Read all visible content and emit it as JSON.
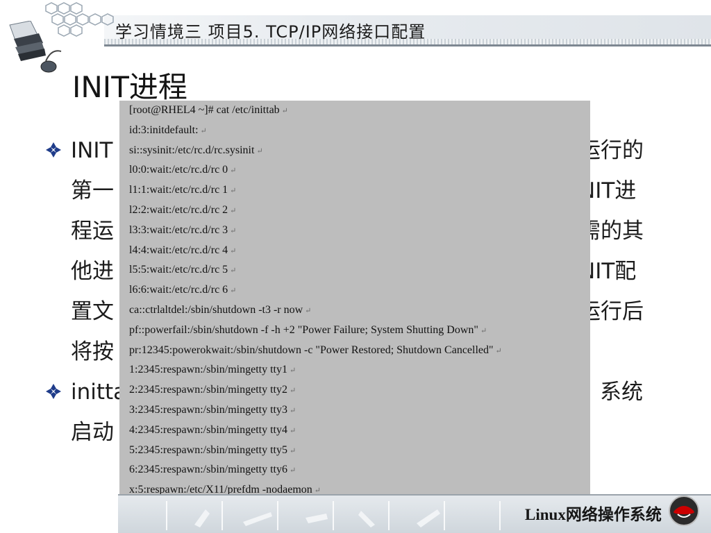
{
  "header": {
    "title": "学习情境三  项目5.  TCP/IP网络接口配置"
  },
  "slide": {
    "title": "INIT进程"
  },
  "body": {
    "p1": {
      "lines": [
        {
          "left": "INIT",
          "right": "运行的"
        },
        {
          "left": "第一",
          "right": "NIT进"
        },
        {
          "left": "程运",
          "right": "需的其"
        },
        {
          "left": "他进",
          "right": "NIT配"
        },
        {
          "left": "置文",
          "right": "运行后"
        },
        {
          "left": "将按",
          "right": ""
        }
      ]
    },
    "p2": {
      "lines": [
        {
          "left": "initta",
          "right": "系统"
        },
        {
          "left": "启动",
          "right": ""
        }
      ]
    }
  },
  "terminal": {
    "lines": [
      "[root@RHEL4 ~]# cat /etc/inittab",
      "id:3:initdefault:",
      "si::sysinit:/etc/rc.d/rc.sysinit",
      "l0:0:wait:/etc/rc.d/rc 0",
      "l1:1:wait:/etc/rc.d/rc 1",
      "l2:2:wait:/etc/rc.d/rc 2",
      "l3:3:wait:/etc/rc.d/rc 3",
      "l4:4:wait:/etc/rc.d/rc 4",
      "l5:5:wait:/etc/rc.d/rc 5",
      "l6:6:wait:/etc/rc.d/rc 6",
      "ca::ctrlaltdel:/sbin/shutdown -t3 -r now",
      "pf::powerfail:/sbin/shutdown -f -h +2 \"Power Failure; System Shutting Down\"",
      "pr:12345:powerokwait:/sbin/shutdown -c \"Power Restored; Shutdown Cancelled\"",
      "1:2345:respawn:/sbin/mingetty tty1",
      "2:2345:respawn:/sbin/mingetty tty2",
      "3:2345:respawn:/sbin/mingetty tty3",
      "4:2345:respawn:/sbin/mingetty tty4",
      "5:2345:respawn:/sbin/mingetty tty5",
      "6:2345:respawn:/sbin/mingetty tty6",
      "x:5:respawn:/etc/X11/prefdm -nodaemon"
    ],
    "line_end_mark": "↵"
  },
  "footer": {
    "label": "Linux网络操作系统"
  },
  "icons": {
    "bullet": "diamond-bullet-icon",
    "logo": "books-mouse-logo-icon",
    "footer_logo": "redhat-shadowman-icon"
  },
  "colors": {
    "terminal_bg": "#bdbdbd",
    "bullet": "#1f3c8a",
    "header_line": "#7d8791"
  }
}
